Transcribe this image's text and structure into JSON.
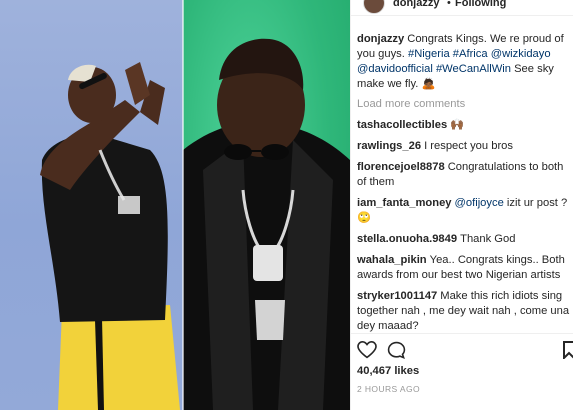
{
  "post": {
    "header": {
      "username": "donjazzy",
      "separator": "•",
      "follow_state": "Following"
    },
    "caption": {
      "username": "donjazzy",
      "text_before": "Congrats Kings. We re proud of you guys. ",
      "tags": [
        "#Nigeria",
        "#Africa",
        "@wizkidayo",
        "@davidoofficial",
        "#WeCanAllWin"
      ],
      "text_after": " See sky make we fly. 🙇🏾"
    },
    "load_more_label": "Load more comments",
    "comments": [
      {
        "username": "tashacollectibles",
        "text": "🙌🏾"
      },
      {
        "username": "rawlings_26",
        "text": "I respect you bros"
      },
      {
        "username": "florencejoel8878",
        "text": "Congratulations to both of them"
      },
      {
        "username": "iam_fanta_money",
        "mention": "@ofijoyce",
        "text": " izit ur post ? 🙄"
      },
      {
        "username": "stella.onuoha.9849",
        "text": "Thank God"
      },
      {
        "username": "wahala_pikin",
        "text": "Yea.. Congrats kings.. Both awards from our best two Nigerian artists"
      },
      {
        "username": "stryker1001147",
        "text": "Make this rich idiots sing together nah , me dey wait nah , come una dey maaad?"
      }
    ],
    "likes": "40,467 likes",
    "time": "2 HOURS AGO"
  },
  "icons": {
    "like": "heart-icon",
    "comment": "comment-bubble-icon",
    "bookmark": "bookmark-icon"
  },
  "colors": {
    "link": "#003569",
    "muted": "#999999",
    "left_bg": "#93a9d8",
    "right_bg": "#2fb77a"
  }
}
